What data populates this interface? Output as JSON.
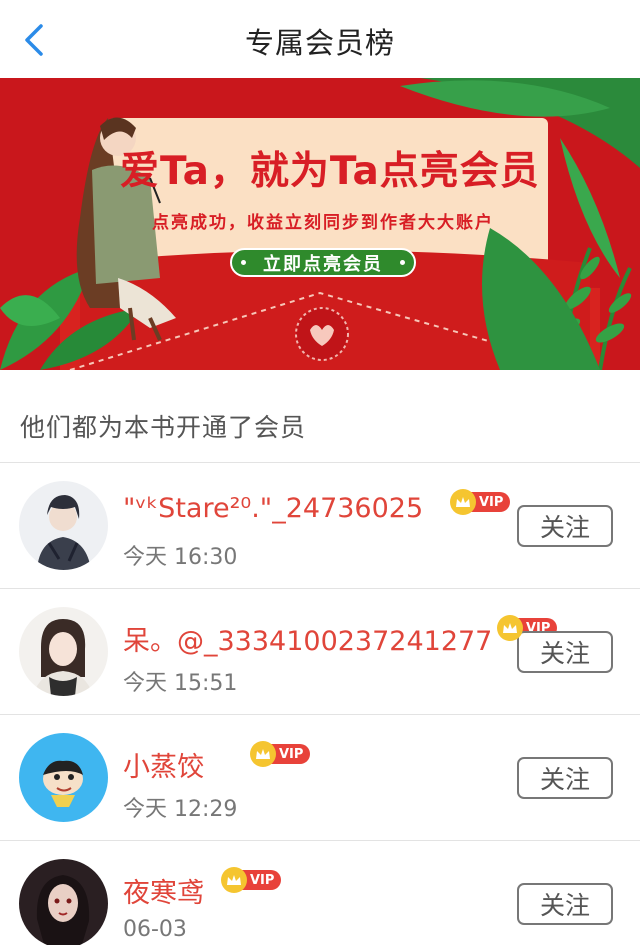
{
  "header": {
    "title": "专属会员榜",
    "back_icon": "chevron-left-icon",
    "accent": "#2b8be8"
  },
  "banner": {
    "headline": "爱Ta，就为Ta点亮会员",
    "subtitle": "点亮成功，收益立刻同步到作者大大账户",
    "button_label": "立即点亮会员",
    "colors": {
      "red": "#c9171c",
      "cream": "#fbe0c4",
      "green": "#2f8a2c"
    }
  },
  "section": {
    "title": "他们都为本书开通了会员"
  },
  "members": [
    {
      "name": "\"ᵛᵏStare²⁰.\"_24736025",
      "time": "今天 16:30",
      "badge": "VIP",
      "follow_label": "关注"
    },
    {
      "name": "呆。@_3334100237241277",
      "time": "今天 15:51",
      "badge": "VIP",
      "follow_label": "关注"
    },
    {
      "name": "小蒸饺",
      "time": "今天 12:29",
      "badge": "VIP",
      "follow_label": "关注"
    },
    {
      "name": "夜寒鸢",
      "time": "06-03",
      "badge": "VIP",
      "follow_label": "关注"
    }
  ]
}
